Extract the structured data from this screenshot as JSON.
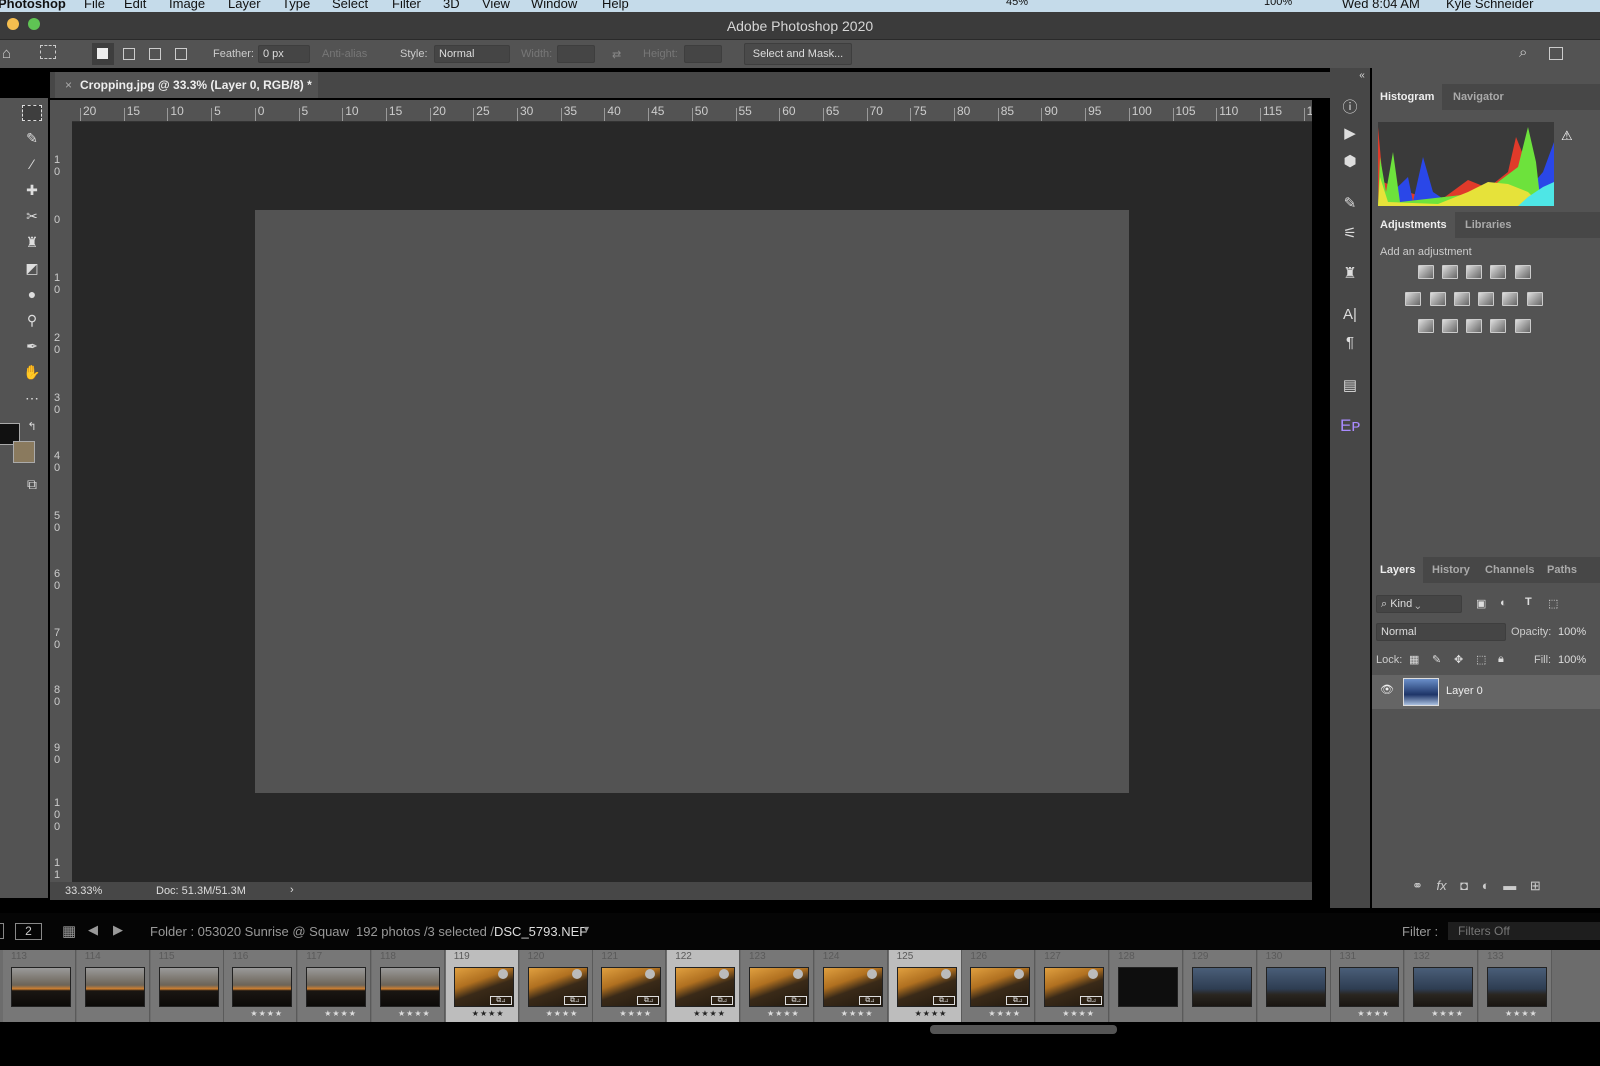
{
  "menubar": {
    "app": "Photoshop",
    "items": [
      "File",
      "Edit",
      "Image",
      "Layer",
      "Type",
      "Select",
      "Filter",
      "3D",
      "View",
      "Window",
      "Help"
    ],
    "battery_small": "45%",
    "battery": "100%",
    "clock": "Wed 8:04 AM",
    "user": "Kyle Schneider"
  },
  "window": {
    "title": "Adobe Photoshop 2020"
  },
  "options": {
    "feather_label": "Feather:",
    "feather_value": "0 px",
    "antialias_label": "Anti-alias",
    "style_label": "Style:",
    "style_value": "Normal",
    "width_label": "Width:",
    "height_label": "Height:",
    "select_mask": "Select and Mask..."
  },
  "document": {
    "tab_title": "Cropping.jpg @ 33.3% (Layer 0, RGB/8) *",
    "zoom": "33.33%",
    "doc_size": "Doc: 51.3M/51.3M"
  },
  "ruler": {
    "h": [
      "20",
      "15",
      "10",
      "5",
      "0",
      "5",
      "10",
      "15",
      "20",
      "25",
      "30",
      "35",
      "40",
      "45",
      "50",
      "55",
      "60",
      "65",
      "70",
      "75",
      "80",
      "85",
      "90",
      "95",
      "100",
      "105",
      "110",
      "115",
      "1"
    ],
    "v": [
      "1 0",
      "0",
      "1 0",
      "2 0",
      "3 0",
      "4 0",
      "5 0",
      "6 0",
      "7 0",
      "8 0",
      "9 0",
      "1 0 0",
      "1 1"
    ]
  },
  "panels": {
    "top_tabs": [
      "Histogram",
      "Navigator"
    ],
    "adj_tabs": [
      "Adjustments",
      "Libraries"
    ],
    "add_adjustment": "Add an adjustment",
    "layer_tabs": [
      "Layers",
      "History",
      "Channels",
      "Paths"
    ],
    "kind": "Kind",
    "blend": "Normal",
    "opacity_label": "Opacity:",
    "opacity_value": "100%",
    "lock_label": "Lock:",
    "fill_label": "Fill:",
    "fill_value": "100%",
    "layers": [
      {
        "name": "Layer 0",
        "visible": true
      }
    ]
  },
  "filmstrip_bar": {
    "page": "2",
    "folder": "Folder : 053020 Sunrise @ Squaw",
    "count": "192 photos /3 selected /",
    "file": "DSC_5793.NEF",
    "filter_label": "Filter :",
    "filter_value": "Filters Off"
  },
  "filmstrip": [
    {
      "n": "113",
      "stars": "",
      "sel": false,
      "tone": "sunset"
    },
    {
      "n": "114",
      "stars": "",
      "sel": false,
      "tone": "sunset"
    },
    {
      "n": "115",
      "stars": "",
      "sel": false,
      "tone": "sunset"
    },
    {
      "n": "116",
      "stars": "★★★★",
      "sel": false,
      "tone": "sunset"
    },
    {
      "n": "117",
      "stars": "★★★★",
      "sel": false,
      "tone": "sunset"
    },
    {
      "n": "118",
      "stars": "★★★★",
      "sel": false,
      "tone": "sunset"
    },
    {
      "n": "119",
      "stars": "★★★★",
      "sel": true,
      "tone": "gold"
    },
    {
      "n": "120",
      "stars": "★★★★",
      "sel": false,
      "tone": "gold"
    },
    {
      "n": "121",
      "stars": "★★★★",
      "sel": false,
      "tone": "gold"
    },
    {
      "n": "122",
      "stars": "★★★★",
      "sel": true,
      "tone": "gold"
    },
    {
      "n": "123",
      "stars": "★★★★",
      "sel": false,
      "tone": "gold"
    },
    {
      "n": "124",
      "stars": "★★★★",
      "sel": false,
      "tone": "gold"
    },
    {
      "n": "125",
      "stars": "★★★★",
      "sel": true,
      "tone": "gold"
    },
    {
      "n": "126",
      "stars": "★★★★",
      "sel": false,
      "tone": "gold"
    },
    {
      "n": "127",
      "stars": "★★★★",
      "sel": false,
      "tone": "gold"
    },
    {
      "n": "128",
      "stars": "",
      "sel": false,
      "tone": "black"
    },
    {
      "n": "129",
      "stars": "",
      "sel": false,
      "tone": "blue"
    },
    {
      "n": "130",
      "stars": "",
      "sel": false,
      "tone": "blue"
    },
    {
      "n": "131",
      "stars": "★★★★",
      "sel": false,
      "tone": "blue"
    },
    {
      "n": "132",
      "stars": "★★★★",
      "sel": false,
      "tone": "blue"
    },
    {
      "n": "133",
      "stars": "★★★★",
      "sel": false,
      "tone": "blue"
    }
  ]
}
